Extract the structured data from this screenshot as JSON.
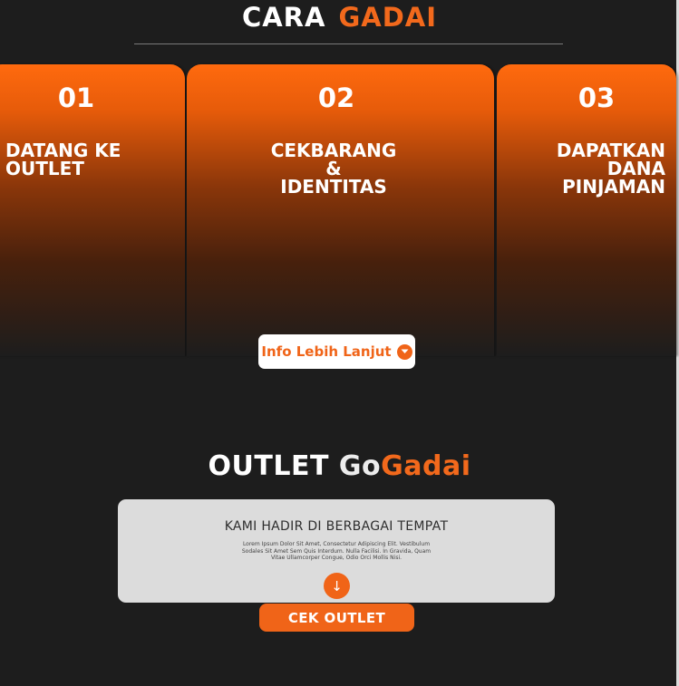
{
  "header": {
    "title_part1": "CARA",
    "title_part2": "GADAI"
  },
  "steps": [
    {
      "number": "01",
      "label": "DATANG KE\nOUTLET"
    },
    {
      "number": "02",
      "label": "CEKBARANG\n&\nIDENTITAS"
    },
    {
      "number": "03",
      "label": "DAPATKAN\nDANA\nPINJAMAN"
    }
  ],
  "info_button": {
    "label": "Info Lebih Lanjut",
    "icon": "chevron-down-icon"
  },
  "outlet": {
    "title_part1": "OUTLET",
    "title_part2": "Go",
    "title_part3": "Gadai",
    "heading": "KAMI HADIR DI BERBAGAI TEMPAT",
    "body": "Lorem Ipsum Dolor Sit Amet, Consectetur Adipiscing Elit. Vestibulum Sodales Sit Amet Sem Quis Interdum. Nulla Facilisi. In Gravida, Quam Vitae Ullamcorper Congue, Odio Orci Mollis Nisi.",
    "arrow": "↓",
    "cta_label": "CEK OUTLET"
  },
  "colors": {
    "accent": "#f2691c",
    "background": "#1d1d1d",
    "panel": "#dcdcdc"
  }
}
